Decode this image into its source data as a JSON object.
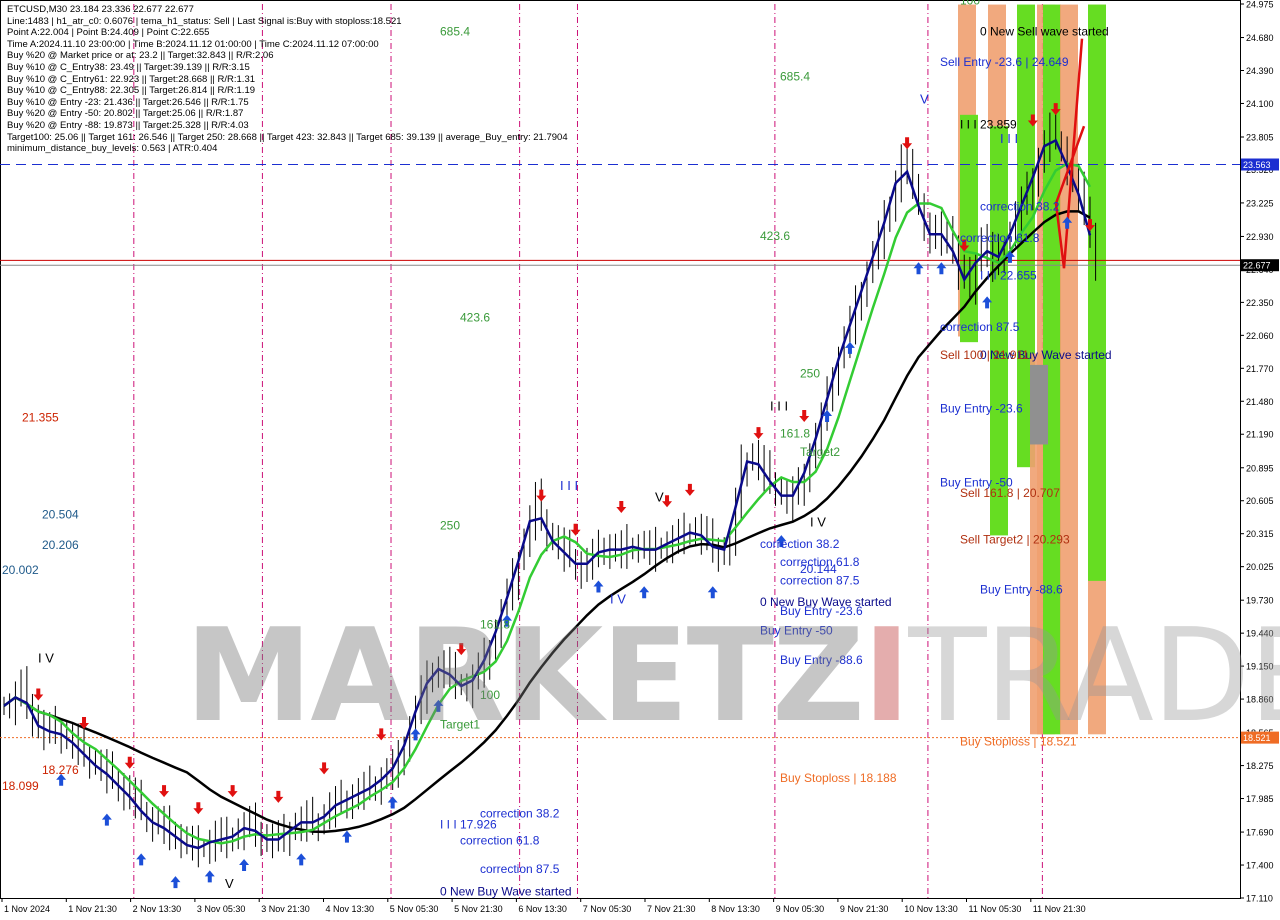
{
  "chart_data": {
    "type": "candlestick",
    "symbol": "ETCUSD,M30",
    "ohlc": {
      "open": "23.184",
      "high": "23.336",
      "low": "22.677",
      "close": "22.677"
    },
    "info_lines": [
      "ETCUSD,M30  23.184 23.336 22.677 22.677",
      "Line:1483 | h1_atr_c0: 0.6076 | tema_h1_status: Sell | Last Signal is:Buy with stoploss:18.521",
      "Point A:22.004 | Point B:24.409 | Point C:22.655",
      "Time A:2024.11.10 23:00:00 | Time B:2024.11.12 01:00:00 | Time C:2024.11.12 07:00:00",
      "Buy %20 @ Market price or at: 23.2 || Target:32.843 || R/R:2.06",
      "Buy %10 @ C_Entry38: 23.49 || Target:39.139 || R/R:3.15",
      "Buy %10 @ C_Entry61: 22.923 || Target:28.668 || R/R:1.31",
      "Buy %10 @ C_Entry88: 22.305 || Target:26.814 || R/R:1.19",
      "Buy %10 @ Entry -23: 21.436 || Target:26.546 || R/R:1.75",
      "Buy %20 @ Entry -50: 20.802 || Target:25.06 || R/R:1.87",
      "Buy %20 @ Entry -88: 19.873 || Target:25.328 || R/R:4.03",
      "Target100: 25.06 || Target 161: 26.546 || Target 250: 28.668 || Target 423: 32.843 || Target 685: 39.139 || average_Buy_entry: 21.7904",
      "minimum_distance_buy_levels: 0.563 | ATR:0.404"
    ],
    "y_ticks": [
      "24.975",
      "24.680",
      "24.390",
      "24.100",
      "23.805",
      "23.520",
      "23.225",
      "22.930",
      "22.640",
      "22.350",
      "22.060",
      "21.770",
      "21.480",
      "21.190",
      "20.895",
      "20.605",
      "20.315",
      "20.025",
      "19.730",
      "19.440",
      "19.150",
      "18.860",
      "18.565",
      "18.275",
      "17.985",
      "17.690",
      "17.400",
      "17.110"
    ],
    "y_range": [
      17.11,
      24.975
    ],
    "x_ticks": [
      "1 Nov 2024",
      "1 Nov 21:30",
      "2 Nov 13:30",
      "3 Nov 05:30",
      "3 Nov 21:30",
      "4 Nov 13:30",
      "5 Nov 05:30",
      "5 Nov 21:30",
      "6 Nov 13:30",
      "7 Nov 05:30",
      "7 Nov 21:30",
      "8 Nov 13:30",
      "9 Nov 05:30",
      "9 Nov 21:30",
      "10 Nov 13:30",
      "11 Nov 05:30",
      "11 Nov 21:30"
    ],
    "price_tags": [
      {
        "value": 23.563,
        "label": "23.563",
        "color": "#1c2fd1"
      },
      {
        "value": 22.677,
        "label": "22.677",
        "color": "#000000"
      },
      {
        "value": 18.521,
        "label": "18.521",
        "color": "#ef6c25"
      }
    ],
    "horizontal_lines": [
      {
        "value": 23.563,
        "style": "dashed",
        "color": "#1c2fd1"
      },
      {
        "value": 22.72,
        "style": "solid",
        "color": "#cc0000"
      },
      {
        "value": 22.677,
        "style": "solid",
        "color": "#888888"
      },
      {
        "value": 18.521,
        "style": "dotted",
        "color": "#ef6c25"
      }
    ],
    "close_series": [
      18.8,
      18.95,
      18.7,
      18.55,
      18.6,
      18.5,
      18.45,
      18.3,
      18.25,
      18.15,
      18.05,
      17.95,
      17.8,
      17.75,
      17.7,
      17.6,
      17.55,
      17.55,
      17.65,
      17.6,
      17.7,
      17.75,
      17.65,
      17.6,
      17.65,
      17.75,
      17.8,
      17.75,
      17.9,
      17.95,
      18.0,
      18.05,
      18.1,
      18.2,
      18.3,
      18.6,
      18.9,
      19.1,
      19.15,
      19.0,
      18.95,
      19.1,
      19.3,
      19.6,
      19.9,
      20.25,
      20.6,
      20.3,
      20.2,
      20.1,
      20.0,
      20.1,
      20.2,
      20.15,
      20.2,
      20.2,
      20.15,
      20.2,
      20.25,
      20.3,
      20.35,
      20.25,
      20.15,
      20.2,
      20.9,
      21.0,
      20.85,
      20.7,
      20.6,
      20.7,
      21.0,
      21.3,
      21.7,
      22.0,
      22.3,
      22.6,
      22.9,
      23.2,
      23.6,
      23.4,
      23.0,
      22.9,
      23.0,
      22.6,
      22.5,
      22.9,
      22.7,
      22.8,
      23.1,
      23.3,
      23.6,
      23.85,
      23.7,
      23.4,
      23.2,
      22.68
    ],
    "series": [
      {
        "name": "tema",
        "color": "#0a0a8a"
      },
      {
        "name": "ema_fast",
        "color": "#33cc33"
      },
      {
        "name": "ema_slow",
        "color": "#000000"
      }
    ],
    "vertical_lines": [
      {
        "at": "2 Nov 13:30",
        "color": "#cc1177"
      },
      {
        "at": "3 Nov 21:30",
        "color": "#cc1177"
      },
      {
        "at": "5 Nov 05:30",
        "color": "#cc1177"
      },
      {
        "at": "6 Nov 13:30",
        "color": "#cc1177"
      },
      {
        "at": "7 Nov 05:30",
        "color": "#cc1177"
      },
      {
        "at": "9 Nov 05:30",
        "color": "#cc1177"
      },
      {
        "at": "10 Nov 13:30",
        "color": "#cc1177"
      },
      {
        "at": "11 Nov 21:30",
        "color": "#cc1177"
      }
    ],
    "annotations": [
      {
        "text": "685.4",
        "value": 24.7,
        "color": "#3a9a3a",
        "at": "left"
      },
      {
        "text": "685.4",
        "value": 24.3,
        "color": "#3a9a3a",
        "at": "mid"
      },
      {
        "text": "0 New Sell wave started",
        "value": 24.7,
        "color": "#000000",
        "at": "right"
      },
      {
        "text": "Sell Entry -23.6 | 24.649",
        "value": 24.43,
        "color": "#1c2fd1",
        "at": "right"
      },
      {
        "text": "I I I 23.859",
        "value": 23.88,
        "color": "#000000",
        "at": "right"
      },
      {
        "text": "correction 38.2",
        "value": 23.16,
        "color": "#1c2fd1",
        "at": "right"
      },
      {
        "text": "423.6",
        "value": 22.9,
        "color": "#3a9a3a",
        "at": "mid"
      },
      {
        "text": "correction 61.8",
        "value": 22.88,
        "color": "#1c2fd1",
        "at": "right"
      },
      {
        "text": "I I I 22.655",
        "value": 22.55,
        "color": "#1c2fd1",
        "at": "right"
      },
      {
        "text": "correction 87.5",
        "value": 22.1,
        "color": "#1c2fd1",
        "at": "right"
      },
      {
        "text": "423.6",
        "value": 22.18,
        "color": "#3a9a3a",
        "at": "left"
      },
      {
        "text": "0 New Buy Wave started",
        "value": 21.85,
        "color": "#0a0a8a",
        "at": "right"
      },
      {
        "text": "Sell 100 | 21.911",
        "value": 21.85,
        "color": "#b03010",
        "at": "right"
      },
      {
        "text": "21.355",
        "value": 21.3,
        "color": "#cc2200",
        "at": "far-left"
      },
      {
        "text": "250",
        "value": 21.69,
        "color": "#3a9a3a",
        "at": "mid"
      },
      {
        "text": "Buy Entry -23.6",
        "value": 21.38,
        "color": "#1c2fd1",
        "at": "right"
      },
      {
        "text": "161.8",
        "value": 21.16,
        "color": "#3a9a3a",
        "at": "mid"
      },
      {
        "text": "Target2",
        "value": 21.0,
        "color": "#3a9a3a",
        "at": "mid"
      },
      {
        "text": "Buy Entry -50",
        "value": 20.73,
        "color": "#1c2fd1",
        "at": "right"
      },
      {
        "text": "Sell 161.8 | 20.707",
        "value": 20.64,
        "color": "#b03010",
        "at": "right"
      },
      {
        "text": "20.504",
        "value": 20.45,
        "color": "#1f5a8a",
        "at": "far-left"
      },
      {
        "text": "250",
        "value": 20.35,
        "color": "#3a9a3a",
        "at": "left"
      },
      {
        "text": "Sell Target2 | 20.293",
        "value": 20.23,
        "color": "#b03010",
        "at": "right"
      },
      {
        "text": "20.206",
        "value": 20.18,
        "color": "#1f5a8a",
        "at": "far-left"
      },
      {
        "text": "correction 38.2",
        "value": 20.19,
        "color": "#1c2fd1",
        "at": "mid"
      },
      {
        "text": "correction 61.8",
        "value": 20.03,
        "color": "#1c2fd1",
        "at": "mid"
      },
      {
        "text": "20.144",
        "value": 19.97,
        "color": "#1c2fd1",
        "at": "mid"
      },
      {
        "text": "20.002",
        "value": 19.96,
        "color": "#1f5a8a",
        "at": "far-left"
      },
      {
        "text": "correction 87.5",
        "value": 19.87,
        "color": "#1c2fd1",
        "at": "mid"
      },
      {
        "text": "Buy Entry -88.6",
        "value": 19.79,
        "color": "#1c2fd1",
        "at": "right"
      },
      {
        "text": "0 New Buy Wave started",
        "value": 19.68,
        "color": "#0a0a8a",
        "at": "mid"
      },
      {
        "text": "Buy Entry -23.6",
        "value": 19.6,
        "color": "#1c2fd1",
        "at": "mid"
      },
      {
        "text": "161.8",
        "value": 19.48,
        "color": "#3a9a3a",
        "at": "left"
      },
      {
        "text": "Buy Entry -50",
        "value": 19.43,
        "color": "#1c2fd1",
        "at": "mid"
      },
      {
        "text": "Buy Entry -88.6",
        "value": 19.17,
        "color": "#1c2fd1",
        "at": "mid"
      },
      {
        "text": "100",
        "value": 18.86,
        "color": "#3a9a3a",
        "at": "left"
      },
      {
        "text": "Target1",
        "value": 18.6,
        "color": "#3a9a3a",
        "at": "left"
      },
      {
        "text": "Buy Stoploss | 18.521",
        "value": 18.45,
        "color": "#ef6c25",
        "at": "right"
      },
      {
        "text": "18.276",
        "value": 18.2,
        "color": "#cc2200",
        "at": "far-left"
      },
      {
        "text": "18.099",
        "value": 18.06,
        "color": "#cc2200",
        "at": "far-left"
      },
      {
        "text": "Buy Stoploss | 18.188",
        "value": 18.13,
        "color": "#ef6c25",
        "at": "mid"
      },
      {
        "text": "correction 38.2",
        "value": 17.82,
        "color": "#1c2fd1",
        "at": "left"
      },
      {
        "text": "I I I 17.926",
        "value": 17.72,
        "color": "#1c2fd1",
        "at": "left"
      },
      {
        "text": "correction 61.8",
        "value": 17.58,
        "color": "#1c2fd1",
        "at": "left"
      },
      {
        "text": "correction 87.5",
        "value": 17.33,
        "color": "#1c2fd1",
        "at": "left"
      },
      {
        "text": "0 New Buy Wave started",
        "value": 17.13,
        "color": "#0a0a8a",
        "at": "left"
      },
      {
        "text": "100",
        "value": 24.97,
        "color": "#3a9a3a",
        "at": "right"
      }
    ],
    "wave_labels": [
      "I V",
      "I I I",
      "V",
      "I V",
      "I I I",
      "V",
      "I V",
      "I I I",
      "V"
    ],
    "watermark": {
      "part1": "MARKETZ",
      "part2": "I",
      "part3": "TRADE"
    },
    "grid": false,
    "legend": "none"
  },
  "colors": {
    "background": "#ffffff",
    "candle": "#000000",
    "buy_arrow": "#1c4fd8",
    "sell_arrow": "#e01010",
    "green_zone": "#66dd22",
    "orange_zone": "#f0a070",
    "grey_zone": "#909090"
  }
}
